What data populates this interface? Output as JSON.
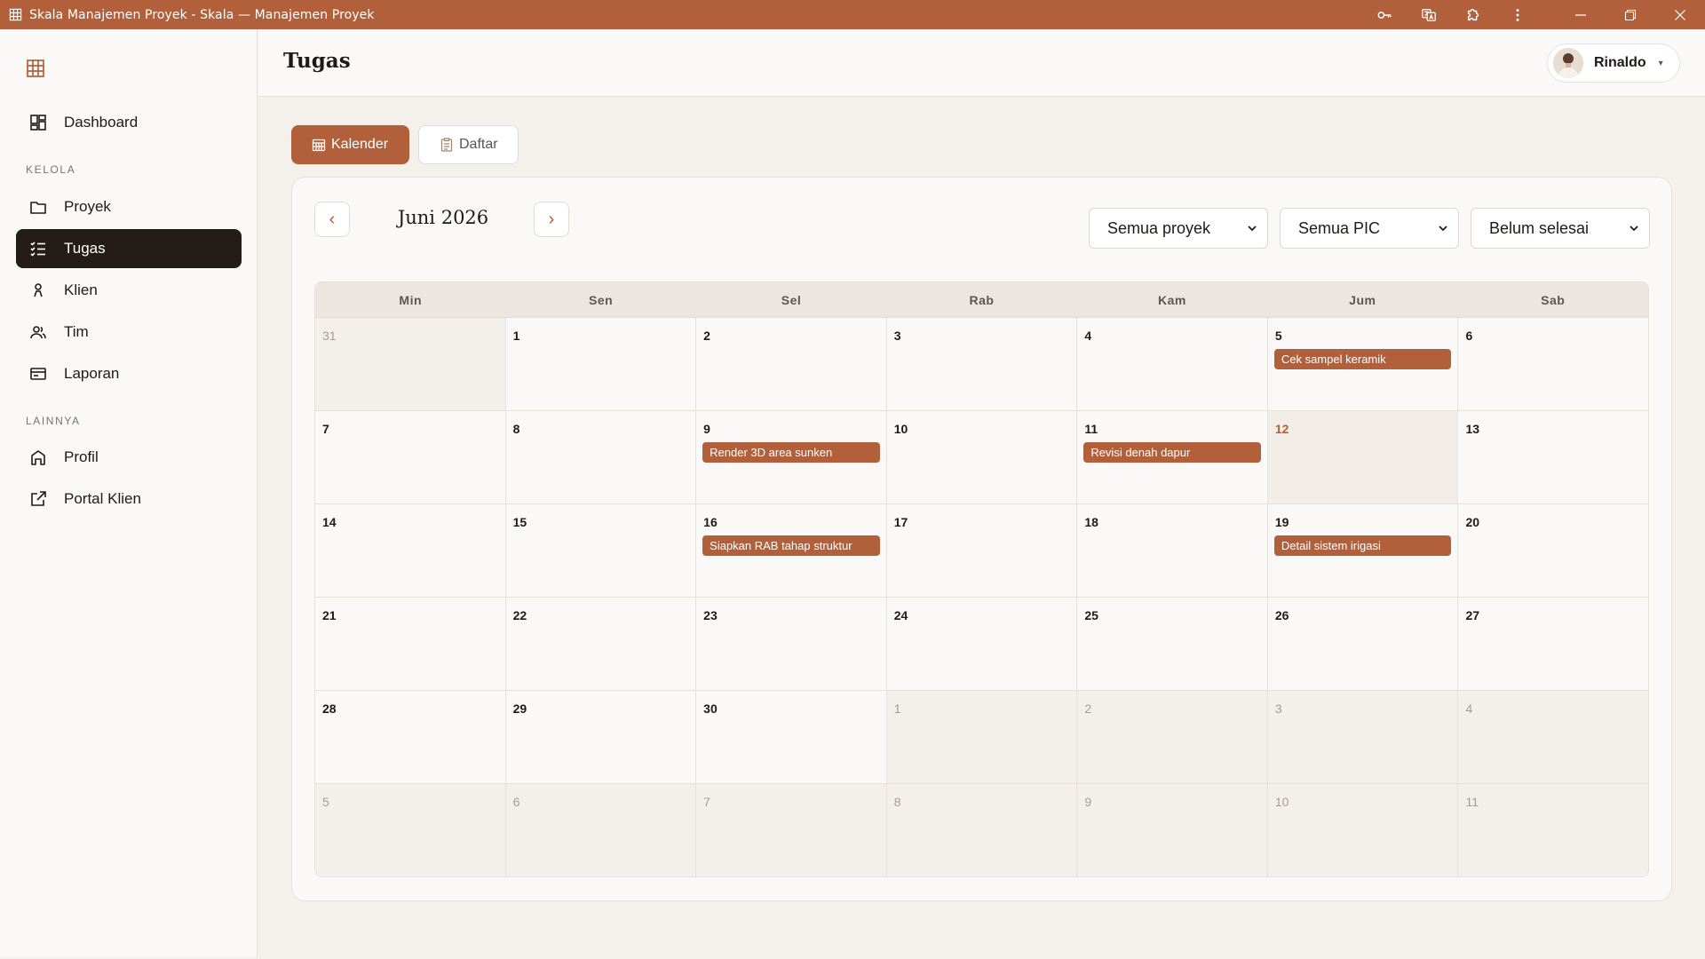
{
  "window": {
    "title": "Skala Manajemen Proyek - Skala — Manajemen Proyek"
  },
  "sidebar": {
    "brand_icon": "grid-logo-icon",
    "items": [
      {
        "label": "Dashboard",
        "icon": "dashboard-icon"
      },
      {
        "label": "Proyek",
        "icon": "folder-icon"
      },
      {
        "label": "Tugas",
        "icon": "checklist-icon",
        "active": true
      },
      {
        "label": "Klien",
        "icon": "person-icon"
      },
      {
        "label": "Tim",
        "icon": "team-icon"
      },
      {
        "label": "Laporan",
        "icon": "report-icon"
      },
      {
        "label": "Profil",
        "icon": "home-icon"
      },
      {
        "label": "Portal Klien",
        "icon": "external-link-icon"
      }
    ],
    "sections": {
      "kelola": "KELOLA",
      "lainnya": "LAINNYA"
    }
  },
  "header": {
    "title": "Tugas",
    "user_name": "Rinaldo"
  },
  "view_tabs": {
    "kalender": "Kalender",
    "daftar": "Daftar"
  },
  "calendar": {
    "month_label": "Juni 2026",
    "prev_label": "‹",
    "next_label": "›",
    "filters": {
      "project": "Semua proyek",
      "pic": "Semua PIC",
      "status": "Belum selesai"
    },
    "weekdays": [
      "Min",
      "Sen",
      "Sel",
      "Rab",
      "Kam",
      "Jum",
      "Sab"
    ],
    "weeks": [
      [
        {
          "n": "31",
          "out": true
        },
        {
          "n": "1"
        },
        {
          "n": "2"
        },
        {
          "n": "3"
        },
        {
          "n": "4"
        },
        {
          "n": "5",
          "event": "Cek sampel keramik"
        },
        {
          "n": "6"
        }
      ],
      [
        {
          "n": "7"
        },
        {
          "n": "8"
        },
        {
          "n": "9",
          "event": "Render 3D area sunken"
        },
        {
          "n": "10"
        },
        {
          "n": "11",
          "event": "Revisi denah dapur"
        },
        {
          "n": "12",
          "today": true
        },
        {
          "n": "13"
        }
      ],
      [
        {
          "n": "14"
        },
        {
          "n": "15"
        },
        {
          "n": "16",
          "event": "Siapkan RAB tahap struktur"
        },
        {
          "n": "17"
        },
        {
          "n": "18"
        },
        {
          "n": "19",
          "event": "Detail sistem irigasi"
        },
        {
          "n": "20"
        }
      ],
      [
        {
          "n": "21"
        },
        {
          "n": "22"
        },
        {
          "n": "23"
        },
        {
          "n": "24"
        },
        {
          "n": "25"
        },
        {
          "n": "26"
        },
        {
          "n": "27"
        }
      ],
      [
        {
          "n": "28"
        },
        {
          "n": "29"
        },
        {
          "n": "30"
        },
        {
          "n": "1",
          "out": true
        },
        {
          "n": "2",
          "out": true
        },
        {
          "n": "3",
          "out": true
        },
        {
          "n": "4",
          "out": true
        }
      ],
      [
        {
          "n": "5",
          "out": true
        },
        {
          "n": "6",
          "out": true
        },
        {
          "n": "7",
          "out": true
        },
        {
          "n": "8",
          "out": true
        },
        {
          "n": "9",
          "out": true
        },
        {
          "n": "10",
          "out": true
        },
        {
          "n": "11",
          "out": true
        }
      ]
    ]
  },
  "colors": {
    "accent": "#b1603b",
    "sidebar_active": "#231c19",
    "background": "#f4f1ec"
  }
}
